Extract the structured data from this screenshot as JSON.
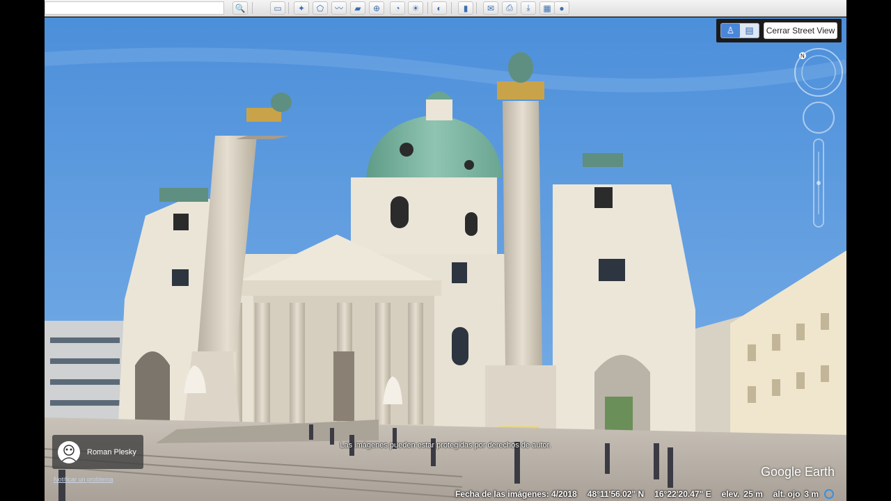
{
  "toolbar": {
    "buttons": [
      {
        "icon": "search-icon",
        "glyph": "🔍"
      },
      {
        "icon": "sidebar-icon",
        "glyph": "▭"
      },
      {
        "icon": "placemark-icon",
        "glyph": "✦"
      },
      {
        "icon": "polygon-icon",
        "glyph": "⬠"
      },
      {
        "icon": "path-icon",
        "glyph": "〰"
      },
      {
        "icon": "overlay-icon",
        "glyph": "▰"
      },
      {
        "icon": "tour-icon",
        "glyph": "⊕"
      },
      {
        "icon": "historical-imagery-icon",
        "glyph": "◔"
      },
      {
        "icon": "sunlight-icon",
        "glyph": "☀"
      },
      {
        "icon": "planets-icon",
        "glyph": "◐"
      },
      {
        "icon": "ruler-icon",
        "glyph": "▮"
      },
      {
        "icon": "email-icon",
        "glyph": "✉"
      },
      {
        "icon": "print-icon",
        "glyph": "⎙"
      },
      {
        "icon": "save-image-icon",
        "glyph": "⤓"
      },
      {
        "icon": "maps-icon",
        "glyph": "▦"
      },
      {
        "icon": "earth-icon",
        "glyph": "●"
      }
    ]
  },
  "street_view": {
    "close_label": "Cerrar Street View"
  },
  "author": {
    "name": "Roman Plesky",
    "report_link": "Notificar un problema"
  },
  "copyright_notice": "Las imágenes pueden estar protegidas por derechos de autor.",
  "logo": "Google Earth",
  "status": {
    "imagery_date": "Fecha de las imágenes: 4/2018",
    "latitude": "48°11'56.02\" N",
    "longitude": "16°22'20.47\" E",
    "elevation_label": "elev.",
    "elevation_value": "25 m",
    "eye_alt_label": "alt. ojo",
    "eye_alt_value": "3 m"
  },
  "colors": {
    "sky": "#5b9be0",
    "dome": "#7fb6a3",
    "stone": "#e9e3d6",
    "pavement": "#bdb6ad"
  }
}
